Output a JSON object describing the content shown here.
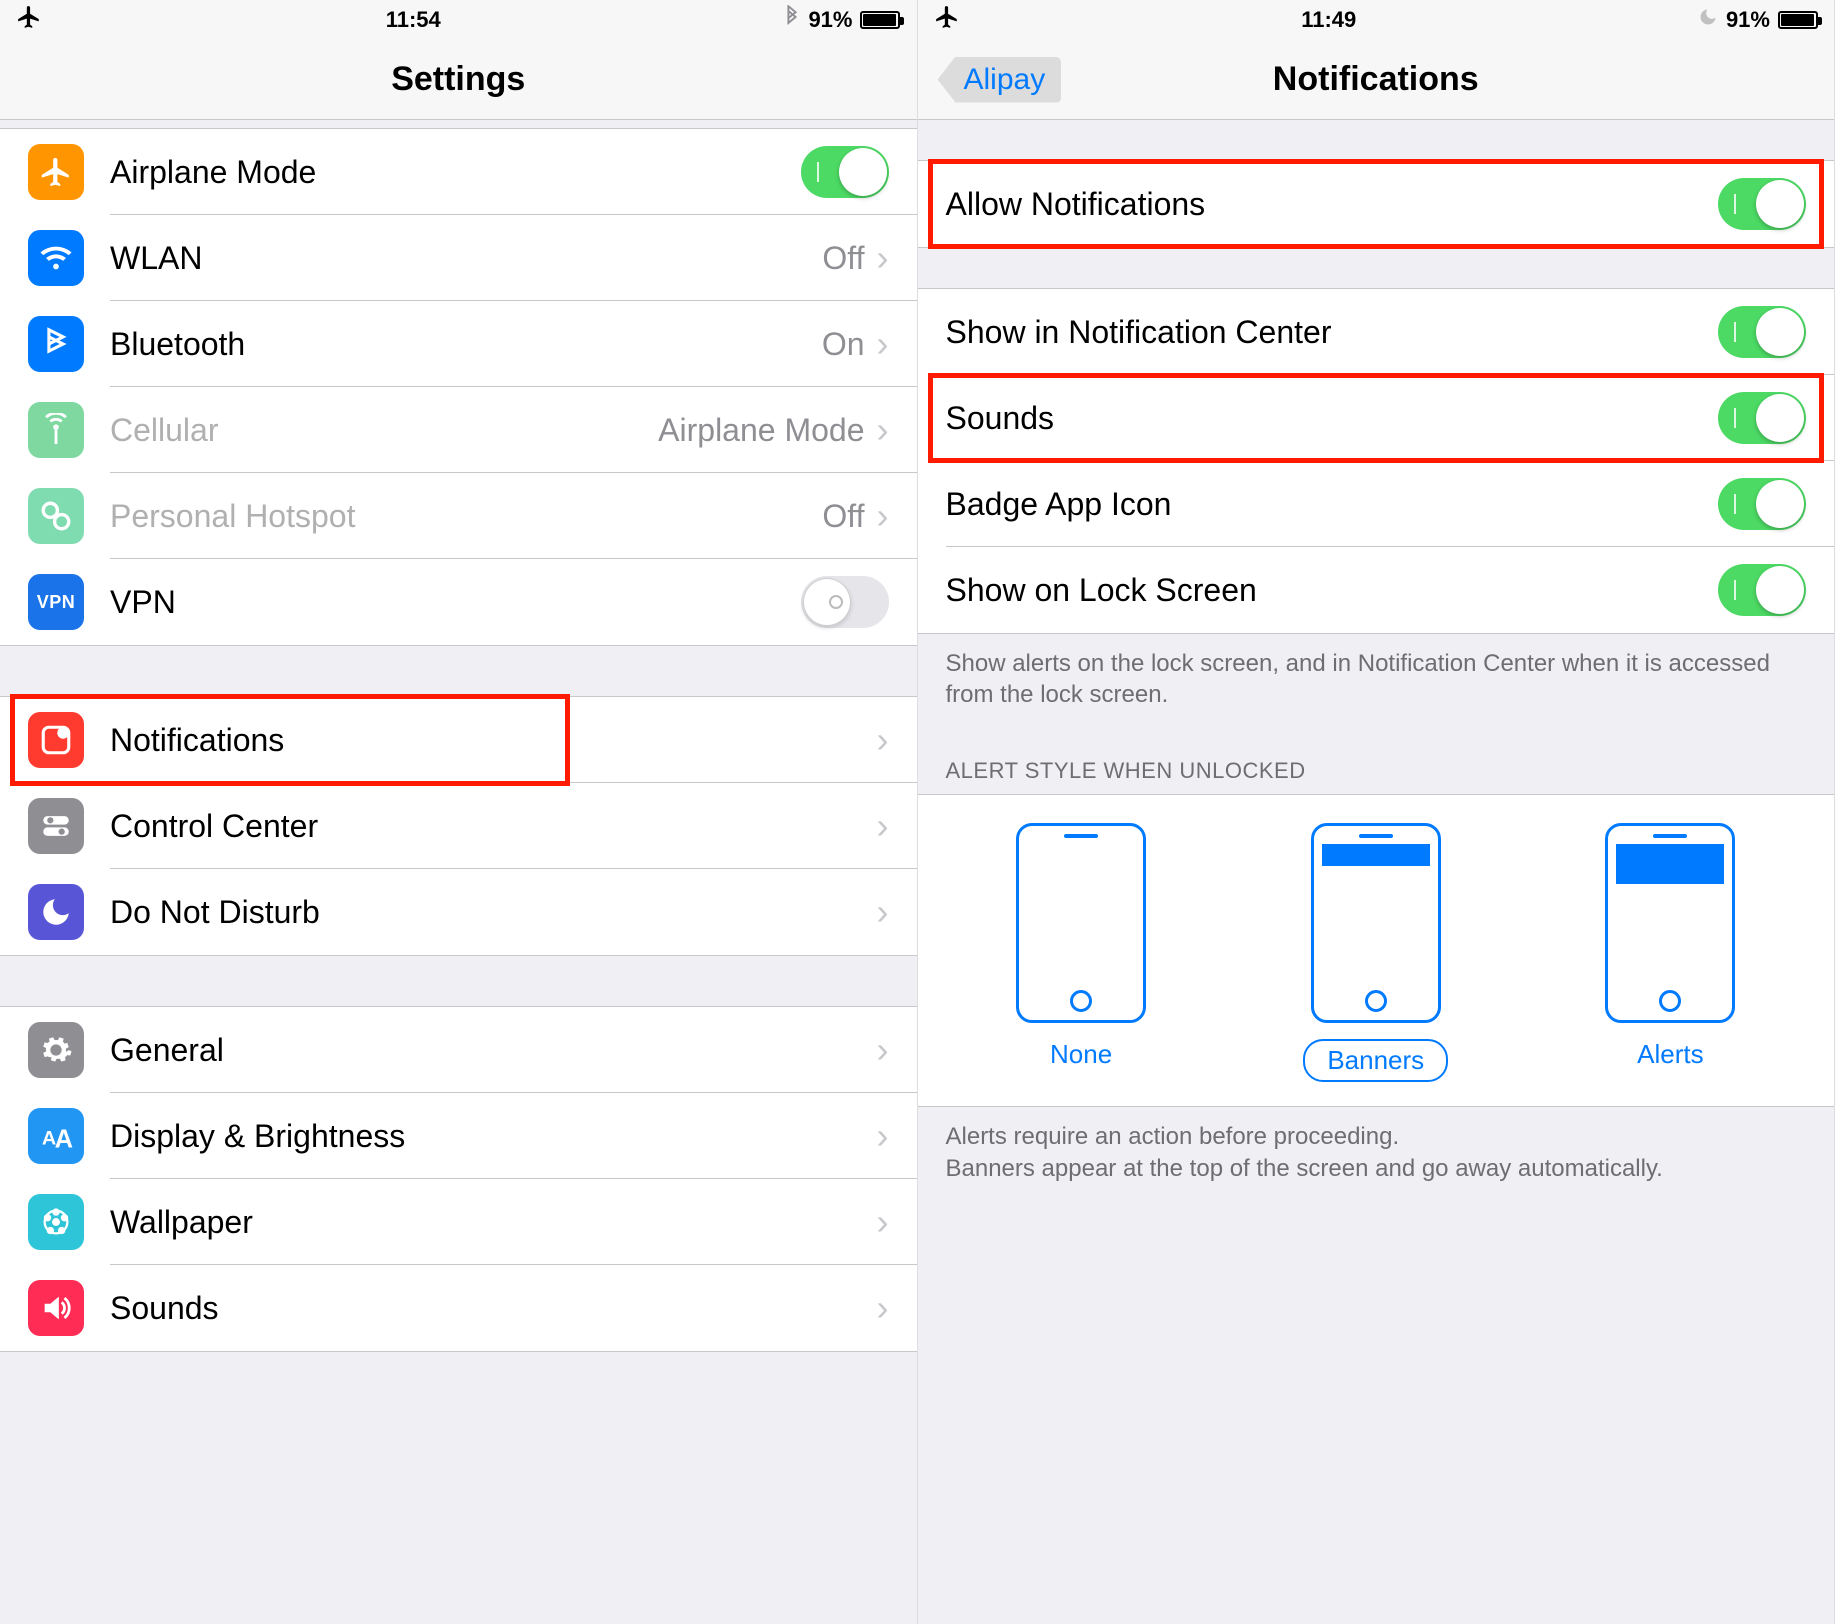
{
  "left": {
    "status": {
      "time": "11:54",
      "battery_pct": "91%",
      "battery_fill": 91
    },
    "title": "Settings",
    "rows1": [
      {
        "icon": "airplane-icon",
        "bg": "bg-orange",
        "label": "Airplane Mode",
        "toggle": "on"
      },
      {
        "icon": "wifi-icon",
        "bg": "bg-blue",
        "label": "WLAN",
        "value": "Off",
        "chev": true
      },
      {
        "icon": "bluetooth-icon",
        "bg": "bg-blue",
        "label": "Bluetooth",
        "value": "On",
        "chev": true
      },
      {
        "icon": "cellular-icon",
        "bg": "bg-greenl",
        "label": "Cellular",
        "value": "Airplane Mode",
        "chev": true,
        "disabled": true
      },
      {
        "icon": "hotspot-icon",
        "bg": "bg-greenl2",
        "label": "Personal Hotspot",
        "value": "Off",
        "chev": true,
        "disabled": true
      },
      {
        "icon": "vpn-icon",
        "bg": "bg-bluev",
        "label": "VPN",
        "toggle": "off",
        "vpn": true
      }
    ],
    "rows2": [
      {
        "icon": "notifications-icon",
        "bg": "bg-red",
        "label": "Notifications",
        "chev": true,
        "highlight": true
      },
      {
        "icon": "control-center-icon",
        "bg": "bg-gray",
        "label": "Control Center",
        "chev": true
      },
      {
        "icon": "dnd-icon",
        "bg": "bg-purple",
        "label": "Do Not Disturb",
        "chev": true
      }
    ],
    "rows3": [
      {
        "icon": "general-icon",
        "bg": "bg-grayd",
        "label": "General",
        "chev": true
      },
      {
        "icon": "display-icon",
        "bg": "bg-blue2",
        "label": "Display & Brightness",
        "chev": true
      },
      {
        "icon": "wallpaper-icon",
        "bg": "bg-teal",
        "label": "Wallpaper",
        "chev": true
      },
      {
        "icon": "sounds-icon",
        "bg": "bg-pink",
        "label": "Sounds",
        "chev": true
      }
    ]
  },
  "right": {
    "status": {
      "time": "11:49",
      "battery_pct": "91%",
      "battery_fill": 91
    },
    "back": "Alipay",
    "title": "Notifications",
    "rowsA": [
      {
        "label": "Allow Notifications",
        "toggle": "on",
        "highlight": true
      }
    ],
    "rowsB": [
      {
        "label": "Show in Notification Center",
        "toggle": "on"
      },
      {
        "label": "Sounds",
        "toggle": "on",
        "highlight": true
      },
      {
        "label": "Badge App Icon",
        "toggle": "on"
      },
      {
        "label": "Show on Lock Screen",
        "toggle": "on"
      }
    ],
    "footer1": "Show alerts on the lock screen, and in Notification Center when it is accessed from the lock screen.",
    "header_alert": "ALERT STYLE WHEN UNLOCKED",
    "alert_opts": [
      {
        "label": "None",
        "kind": "none"
      },
      {
        "label": "Banners",
        "kind": "banner",
        "selected": true
      },
      {
        "label": "Alerts",
        "kind": "alert"
      }
    ],
    "footer2": "Alerts require an action before proceeding.\nBanners appear at the top of the screen and go away automatically."
  }
}
